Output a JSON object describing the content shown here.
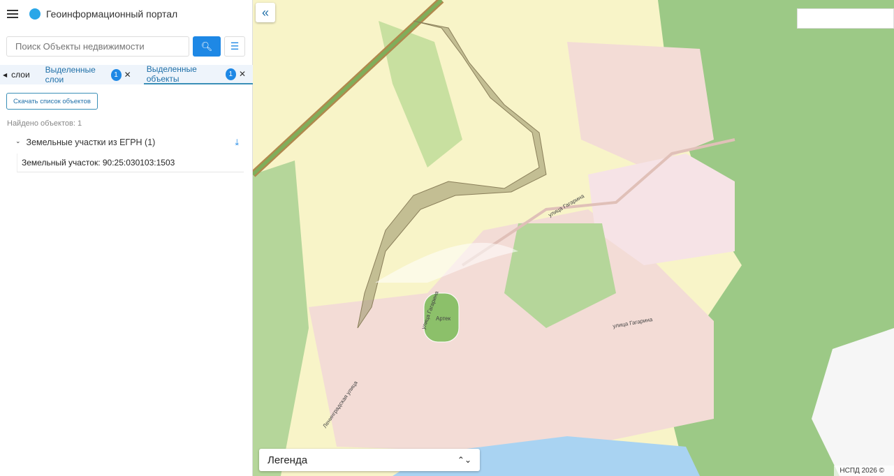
{
  "header": {
    "title": "Геоинформационный портал"
  },
  "search": {
    "placeholder": "Поиск Объекты недвижимости"
  },
  "tabs": [
    {
      "label": "слои"
    },
    {
      "label": "Выделенные слои",
      "count": "1"
    },
    {
      "label": "Выделенные объекты",
      "count": "1"
    }
  ],
  "download_button": "Скачать список объектов",
  "found": "Найдено объектов: 1",
  "group": {
    "label": "Земельные участки из ЕГРН (1)"
  },
  "items": [
    {
      "label": "Земельный участок: 90:25:030103:1503"
    }
  ],
  "map": {
    "labels": [
      "улица Гагарина",
      "улица Гагарина",
      "Артек",
      "улица Гагарина",
      "Ленинградская улица"
    ],
    "legend": "Легенда",
    "copyright": "НСПД 2026 ©"
  },
  "colors": {
    "accent": "#1e88e5",
    "forest": "#9cc986",
    "urban": "#f3dcd6",
    "sea": "#a9d3f2",
    "fields": "#f8f4c8"
  }
}
